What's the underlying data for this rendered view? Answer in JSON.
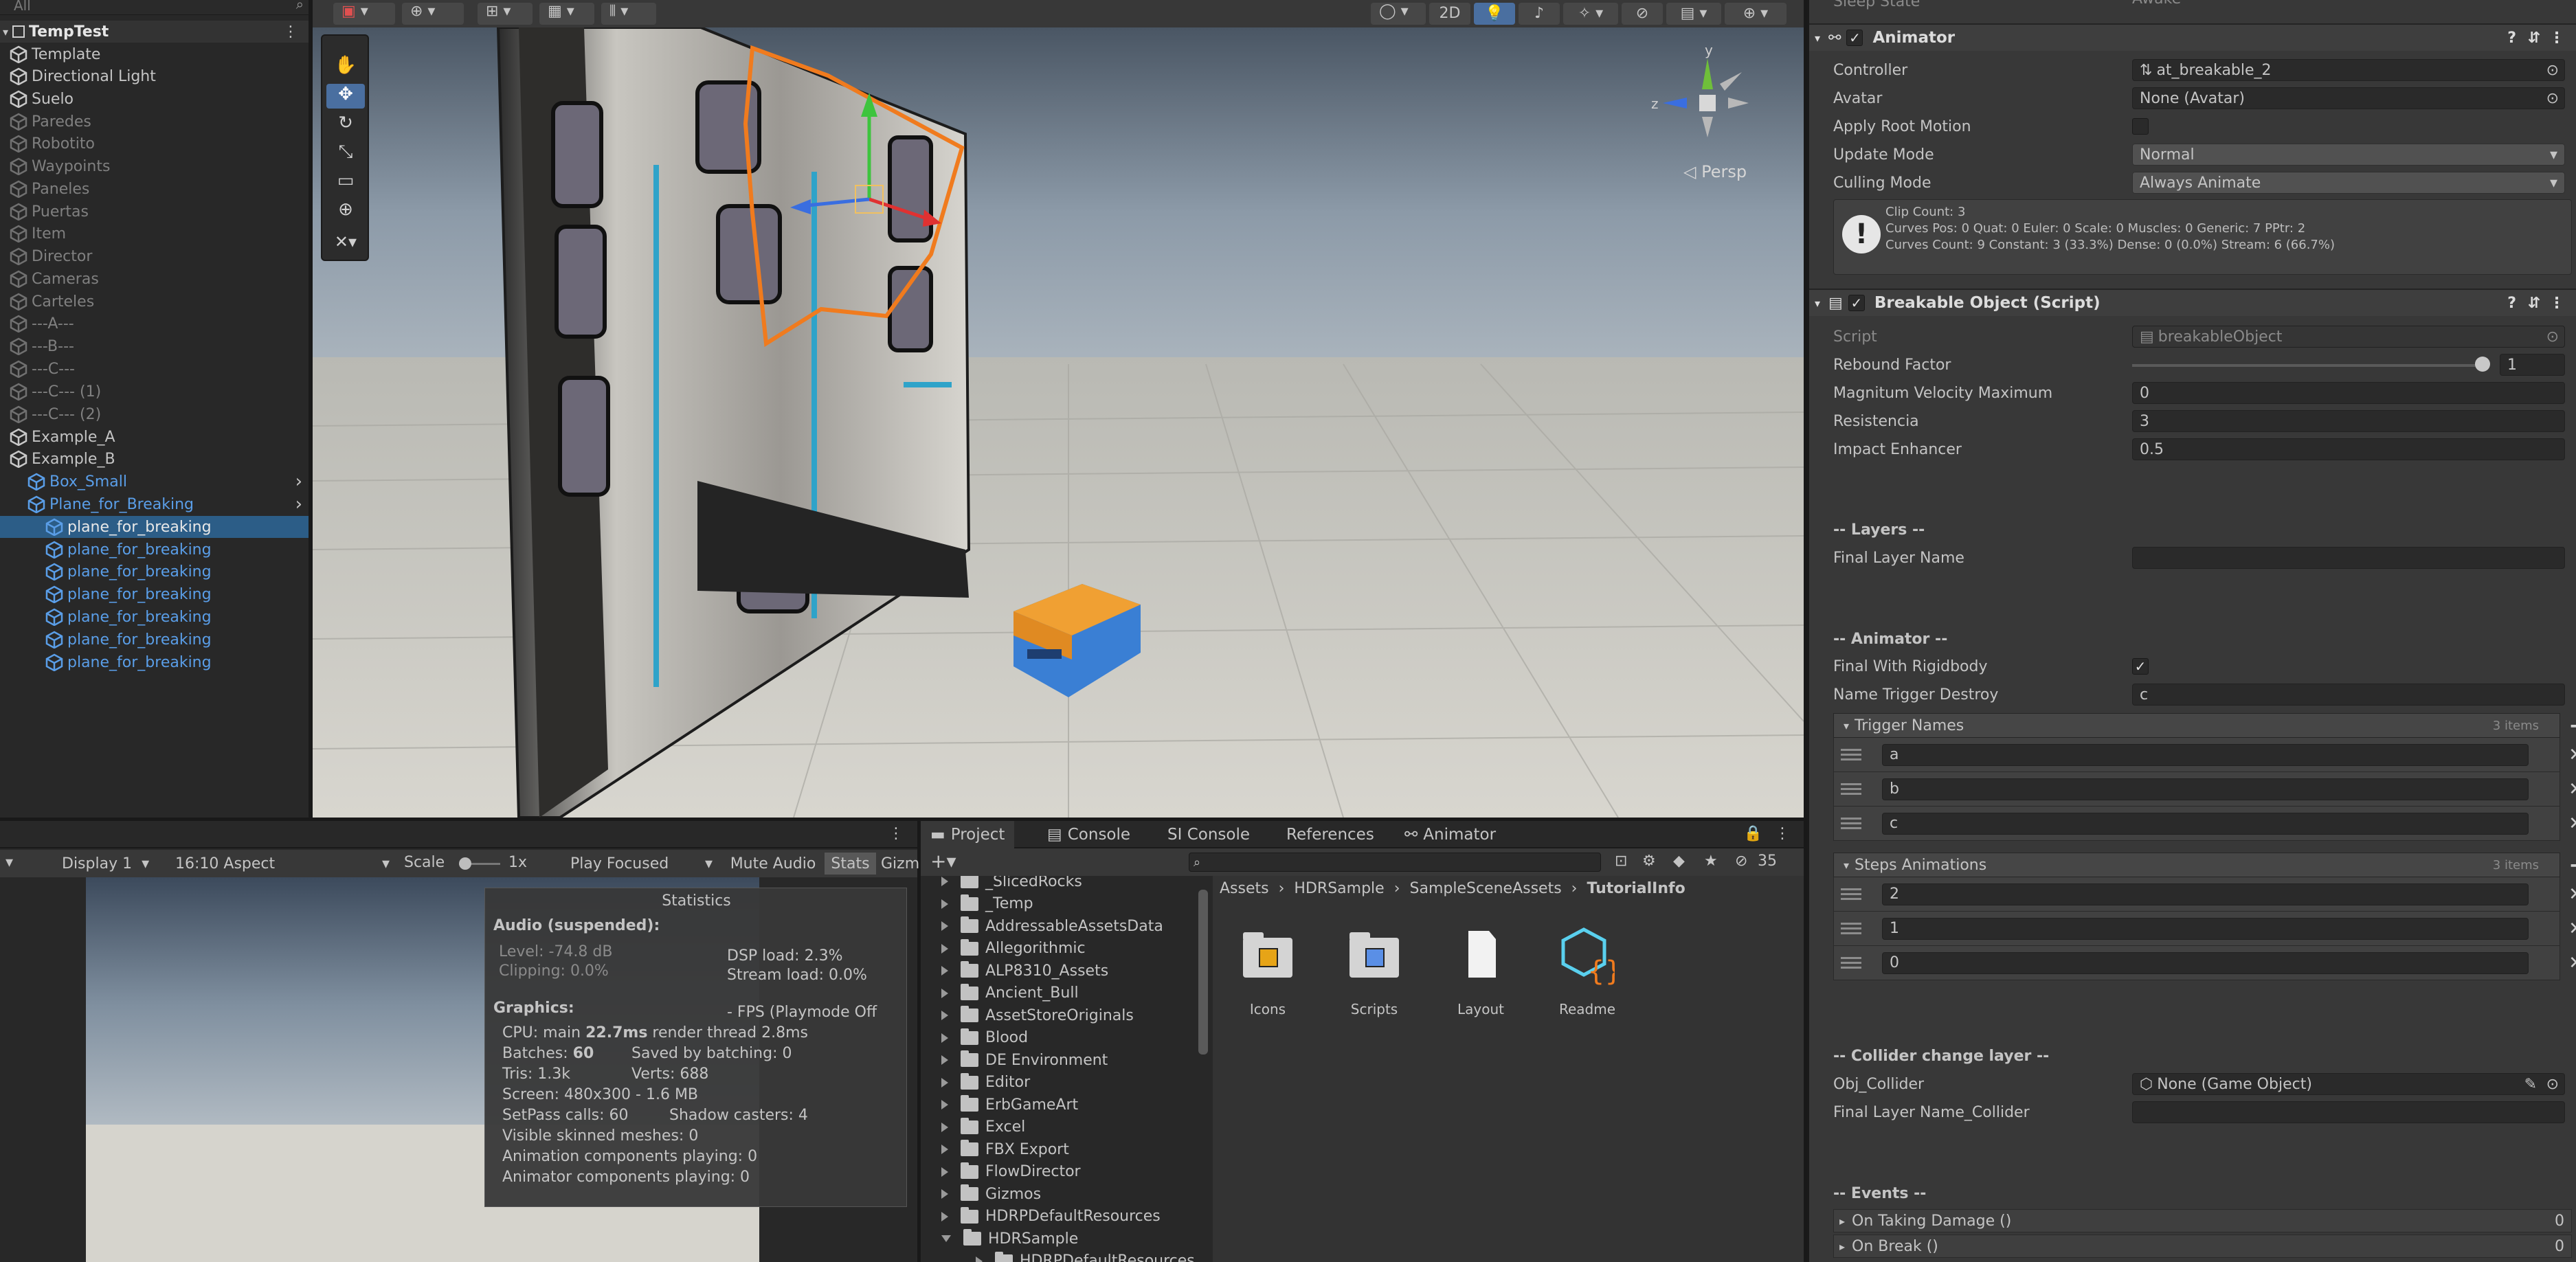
{
  "hierarchy": {
    "search_placeholder": "All",
    "scene_name": "TempTest",
    "items": [
      {
        "label": "Template",
        "state": "normal"
      },
      {
        "label": "Directional Light",
        "state": "normal"
      },
      {
        "label": "Suelo",
        "state": "normal"
      },
      {
        "label": "Paredes",
        "state": "disabled"
      },
      {
        "label": "Robotito",
        "state": "disabled"
      },
      {
        "label": "Waypoints",
        "state": "disabled"
      },
      {
        "label": "Paneles",
        "state": "disabled"
      },
      {
        "label": "Puertas",
        "state": "disabled"
      },
      {
        "label": "Item",
        "state": "disabled"
      },
      {
        "label": "Director",
        "state": "disabled"
      },
      {
        "label": "Cameras",
        "state": "disabled"
      },
      {
        "label": "Carteles",
        "state": "disabled"
      },
      {
        "label": "---A---",
        "state": "disabled"
      },
      {
        "label": "---B---",
        "state": "disabled"
      },
      {
        "label": "---C---",
        "state": "disabled"
      },
      {
        "label": "---C--- (1)",
        "state": "disabled"
      },
      {
        "label": "---C--- (2)",
        "state": "disabled"
      },
      {
        "label": "Example_A",
        "state": "normal"
      },
      {
        "label": "Example_B",
        "state": "normal"
      },
      {
        "label": "Box_Small",
        "state": "prefab"
      },
      {
        "label": "Plane_for_Breaking",
        "state": "prefab"
      },
      {
        "label": "plane_for_breaking",
        "state": "selected"
      },
      {
        "label": "plane_for_breaking",
        "state": "prefab"
      },
      {
        "label": "plane_for_breaking",
        "state": "prefab"
      },
      {
        "label": "plane_for_breaking",
        "state": "prefab"
      },
      {
        "label": "plane_for_breaking",
        "state": "prefab"
      },
      {
        "label": "plane_for_breaking",
        "state": "prefab"
      },
      {
        "label": "plane_for_breaking",
        "state": "prefab"
      }
    ]
  },
  "scene": {
    "toolbar_2d": "2D",
    "persp_label": "◁ Persp",
    "gizmo_axes": {
      "y": "y",
      "z": "z"
    }
  },
  "inspector": {
    "top_cut_label": "Sleep State",
    "top_cut_value": "Awake",
    "animator": {
      "title": "Animator",
      "controller_label": "Controller",
      "controller_value": "at_breakable_2",
      "avatar_label": "Avatar",
      "avatar_value": "None (Avatar)",
      "apply_root_label": "Apply Root Motion",
      "update_mode_label": "Update Mode",
      "update_mode_value": "Normal",
      "culling_label": "Culling Mode",
      "culling_value": "Always Animate",
      "info_line1": "Clip Count: 3",
      "info_line2": "Curves Pos: 0 Quat: 0 Euler: 0 Scale: 0 Muscles: 0 Generic: 7 PPtr: 2",
      "info_line3": "Curves Count: 9 Constant: 3 (33.3%) Dense: 0 (0.0%) Stream: 6 (66.7%)"
    },
    "breakable": {
      "title": "Breakable Object (Script)",
      "script_label": "Script",
      "script_value": "breakableObject",
      "rebound_label": "Rebound Factor",
      "rebound_value": "1",
      "rebound_fraction": 1,
      "magnitum_label": "Magnitum Velocity Maximum",
      "magnitum_value": "0",
      "resistencia_label": "Resistencia",
      "resistencia_value": "3",
      "impact_label": "Impact Enhancer",
      "impact_value": "0.5",
      "layers_header": "-- Layers --",
      "final_layer_label": "Final Layer Name",
      "final_layer_value": "",
      "animator_header": "-- Animator --",
      "final_rigid_label": "Final With Rigidbody",
      "name_trigger_label": "Name Trigger Destroy",
      "name_trigger_value": "c",
      "trigger_names_label": "Trigger Names",
      "trigger_names_count": "3 items",
      "trigger_names": [
        "a",
        "b",
        "c"
      ],
      "steps_label": "Steps Animations",
      "steps_count": "3 items",
      "steps": [
        "2",
        "1",
        "0"
      ],
      "collider_header": "-- Collider change layer --",
      "obj_collider_label": "Obj_Collider",
      "obj_collider_value": "None (Game Object)",
      "final_layer_collider_label": "Final Layer Name_Collider",
      "final_layer_collider_value": "",
      "events_header": "-- Events --",
      "on_taking_damage": "On Taking Damage ()",
      "on_taking_damage_count": "0",
      "on_break": "On Break ()",
      "on_break_count": "0"
    }
  },
  "game": {
    "display": "Display 1",
    "aspect": "16:10 Aspect",
    "scale_label": "Scale",
    "scale_value": "1x",
    "play_focused": "Play Focused",
    "mute_audio": "Mute Audio",
    "stats": "Stats",
    "gizmos": "Gizm",
    "stats_panel": {
      "title": "Statistics",
      "audio_header": "Audio (suspended):",
      "level": "Level: -74.8 dB",
      "clipping": "Clipping: 0.0%",
      "dsp": "DSP load: 2.3%",
      "stream": "Stream load: 0.0%",
      "graphics_header": "Graphics:",
      "fps": "- FPS (Playmode Off",
      "cpu_prefix": "CPU: main",
      "cpu_main": "22.7ms",
      "render_thread": "render thread 2.8ms",
      "batches_prefix": "Batches:",
      "batches": "60",
      "saved_batching": "Saved by batching: 0",
      "tris": "Tris: 1.3k",
      "verts": "Verts: 688",
      "screen": "Screen: 480x300 - 1.6 MB",
      "setpass": "SetPass calls: 60",
      "shadow": "Shadow casters: 4",
      "skinned": "Visible skinned meshes: 0",
      "anim_components": "Animation components playing: 0",
      "animator_components": "Animator components playing: 0"
    }
  },
  "project": {
    "tabs": [
      "Project",
      "Console",
      "SI Console",
      "References",
      "Animator"
    ],
    "hidden_count": "35",
    "folders": [
      "_SlicedRocks",
      "_Temp",
      "AddressableAssetsData",
      "Allegorithmic",
      "ALP8310_Assets",
      "Ancient_Bull",
      "AssetStoreOriginals",
      "Blood",
      "DE Environment",
      "Editor",
      "ErbGameArt",
      "Excel",
      "FBX Export",
      "FlowDirector",
      "Gizmos",
      "HDRPDefaultResources",
      "HDRSample",
      "HDRPDefaultResources"
    ],
    "breadcrumb": [
      "Assets",
      "HDRSample",
      "SampleSceneAssets",
      "TutorialInfo"
    ],
    "assets": [
      "Icons",
      "Scripts",
      "Layout",
      "Readme"
    ]
  }
}
